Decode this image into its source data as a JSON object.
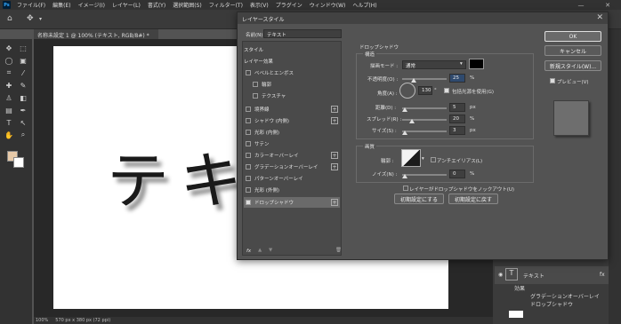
{
  "menubar": {
    "logo": "Ps",
    "items": [
      "ファイル(F)",
      "編集(E)",
      "イメージ(I)",
      "レイヤー(L)",
      "書式(Y)",
      "選択範囲(S)",
      "フィルター(T)",
      "表示(V)",
      "プラグイン",
      "ウィンドウ(W)",
      "ヘルプ(H)"
    ],
    "minimize": "—",
    "close": "✕"
  },
  "document": {
    "tab": "名称未設定 1 @ 100% (テキスト, RGB/8#) *",
    "canvas_text": "テキ",
    "zoom": "100%",
    "size_info": "570 px x 380 px (72 ppi)"
  },
  "dialog": {
    "title": "レイヤースタイル",
    "name_label": "名前(N):",
    "name_value": "テキスト",
    "style_header": "スタイル",
    "blend_header": "レイヤー効果",
    "bevel": "ベベルとエンボス",
    "contour": "輪郭",
    "texture": "テクスチャ",
    "stroke": "境界線",
    "inner_shadow": "シャドウ (内側)",
    "inner_glow": "光彩 (内側)",
    "satin": "サテン",
    "color_overlay": "カラーオーバーレイ",
    "gradient_overlay": "グラデーションオーバーレイ",
    "pattern_overlay": "パターンオーバーレイ",
    "outer_glow": "光彩 (外側)",
    "drop_shadow": "ドロップシャドウ",
    "fx": "fx",
    "section_title": "ドロップシャドウ",
    "structure": "構造",
    "blend_mode_label": "描画モード :",
    "blend_mode_value": "通常",
    "opacity_label": "不透明度(O) :",
    "opacity_value": "25",
    "percent": "%",
    "angle_label": "角度(A) :",
    "angle_value": "130",
    "degree": "°",
    "global_light": "包括光源を使用(G)",
    "distance_label": "距離(D) :",
    "distance_value": "5",
    "spread_label": "スプレッド(R) :",
    "spread_value": "20",
    "size_label": "サイズ(S) :",
    "size_value": "3",
    "px": "px",
    "quality": "画質",
    "contour_label": "輪郭 :",
    "antialias": "アンチエイリアス(L)",
    "noise_label": "ノイズ(N) :",
    "noise_value": "0",
    "knockout": "レイヤーがドロップシャドウをノックアウト(U)",
    "make_default": "初期設定にする",
    "reset_default": "初期設定に戻す",
    "ok": "OK",
    "cancel": "キャンセル",
    "new_style": "新規スタイル(W)...",
    "preview": "プレビュー(V)",
    "shadow_color": "#000000",
    "close": "✕"
  },
  "layers": {
    "text_layer": "テキスト",
    "effects": "効果",
    "gradient": "グラデーションオーバーレイ",
    "drop_shadow": "ドロップシャドウ",
    "fx": "fx"
  }
}
